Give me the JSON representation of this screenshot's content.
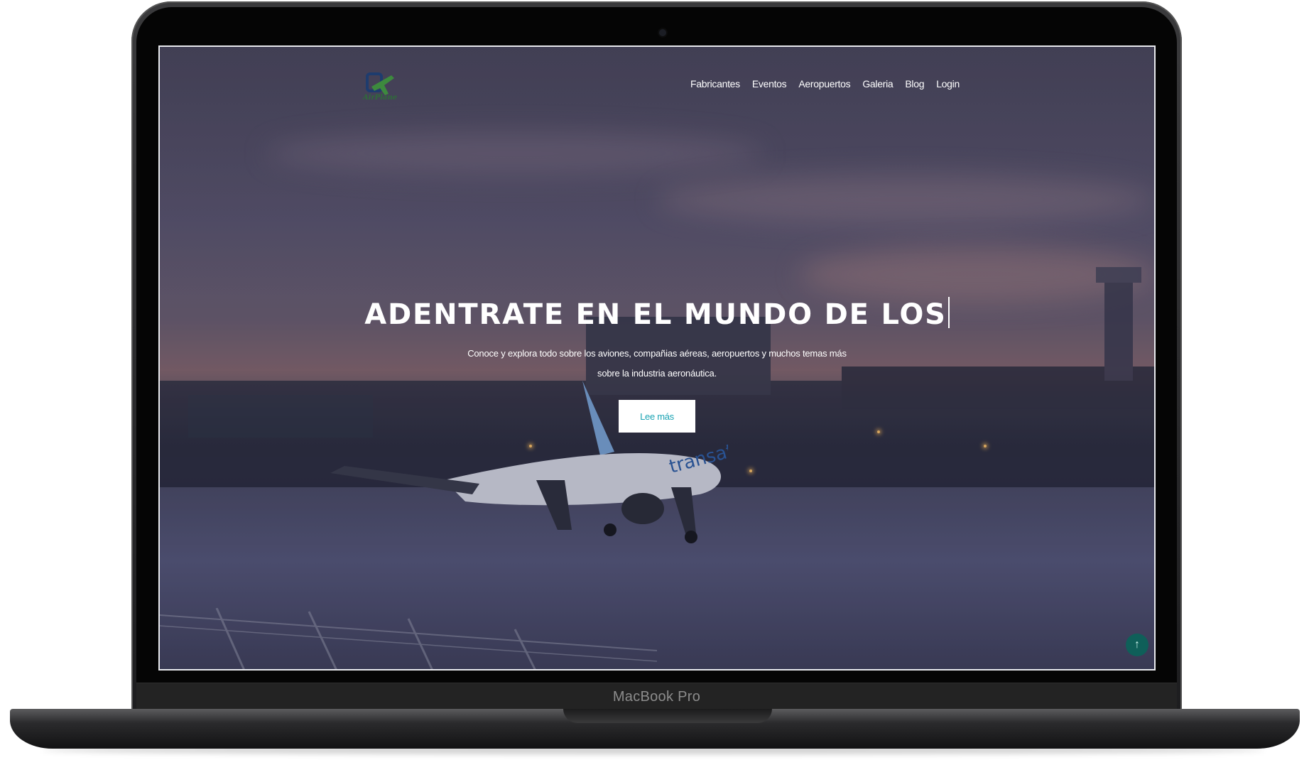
{
  "device": {
    "brand_label": "MacBook Pro"
  },
  "site": {
    "logo_text": "AirPlane",
    "nav": [
      "Fabricantes",
      "Eventos",
      "Aeropuertos",
      "Galeria",
      "Blog",
      "Login"
    ]
  },
  "hero": {
    "title": "ADENTRATE EN EL MUNDO DE LOS",
    "subtitle_line1": "Conoce y explora todo sobre los aviones, compañias aéreas, aeropuertos y muchos temas más",
    "subtitle_line2": "sobre la industria aeronáutica.",
    "cta_label": "Lee más"
  },
  "icons": {
    "scroll_top": "arrow-up-icon",
    "logo": "airplane-logo-icon"
  },
  "colors": {
    "cta_text": "#1aa3b3",
    "scroll_top_bg": "#0f5f59",
    "logo_green": "#2f6b3a"
  }
}
